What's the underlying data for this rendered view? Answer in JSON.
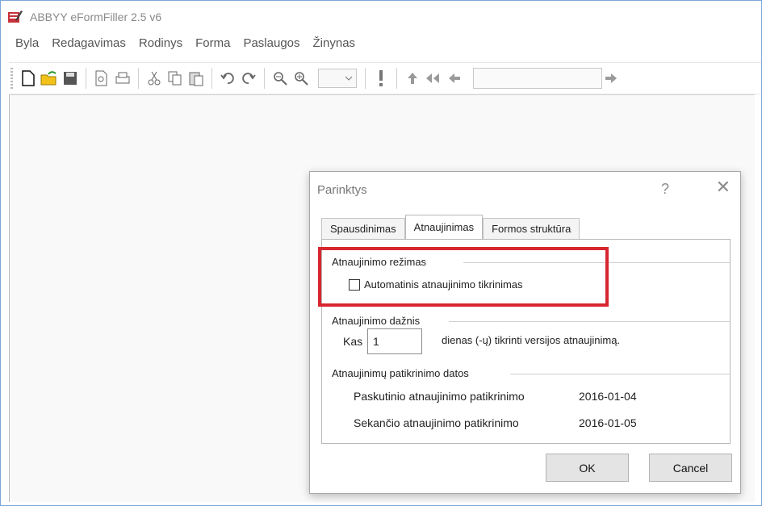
{
  "app": {
    "title": "ABBYY eFormFiller 2.5 v6"
  },
  "menu": [
    "Byla",
    "Redagavimas",
    "Rodinys",
    "Forma",
    "Paslaugos",
    "Žinynas"
  ],
  "toolbar": {
    "icons": [
      "new-file-icon",
      "open-folder-icon",
      "save-icon",
      "print-preview-icon",
      "print-icon",
      "cut-icon",
      "copy-icon",
      "paste-icon",
      "undo-icon",
      "redo-icon",
      "zoom-out-icon",
      "zoom-in-icon",
      "zoom-dropdown",
      "exclamation-icon",
      "nav-up-icon",
      "nav-double-left-icon",
      "nav-left-icon",
      "address-field",
      "nav-right-icon"
    ]
  },
  "dialog": {
    "title": "Parinktys",
    "help": "?",
    "close": "✕",
    "tabs": [
      "Spausdinimas",
      "Atnaujinimas",
      "Formos struktūra"
    ],
    "active_tab": "Atnaujinimas",
    "group1": {
      "title": "Atnaujinimo režimas",
      "checkbox_label": "Automatinis atnaujinimo tikrinimas",
      "checked": false
    },
    "group2": {
      "title": "Atnaujinimo dažnis",
      "prefix": "Kas",
      "value": "1",
      "suffix": "dienas (-ų) tikrinti versijos atnaujinimą."
    },
    "group3": {
      "title": "Atnaujinimų patikrinimo datos",
      "rows": [
        {
          "label": "Paskutinio atnaujinimo patikrinimo",
          "value": "2016-01-04"
        },
        {
          "label": "Sekančio atnaujinimo patikrinimo",
          "value": "2016-01-05"
        }
      ]
    },
    "buttons": {
      "ok": "OK",
      "cancel": "Cancel"
    }
  },
  "colors": {
    "highlight": "#d7262f",
    "window_border": "#7aa6d8"
  }
}
